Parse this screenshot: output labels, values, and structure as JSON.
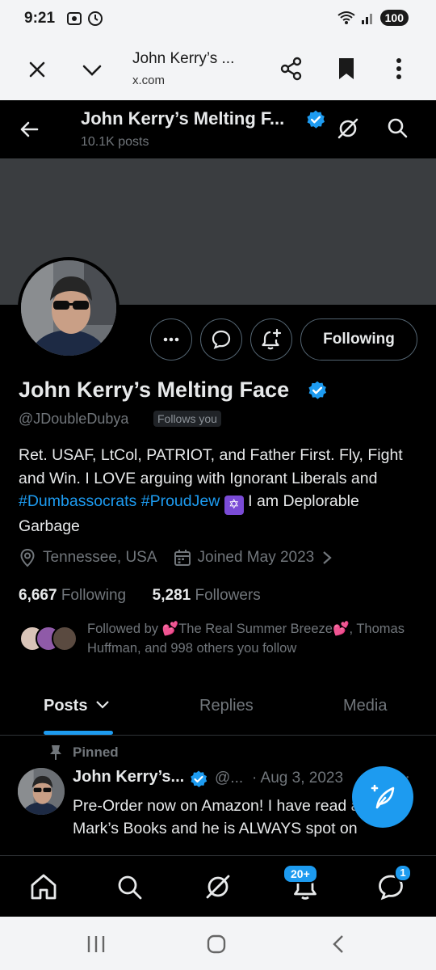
{
  "status_bar": {
    "time": "9:21",
    "battery": "100"
  },
  "browser": {
    "title": "John Kerry’s ...",
    "url": "x.com"
  },
  "header": {
    "name": "John Kerry’s Melting F...",
    "posts": "10.1K posts"
  },
  "profile": {
    "name": "John Kerry’s Melting Face",
    "handle": "@JDoubleDubya",
    "follows_you": "Follows you",
    "following_button": "Following",
    "bio_1": "Ret. USAF, LtCol, PATRIOT, and Father First. Fly, Fight and Win. I LOVE arguing with Ignorant Liberals and ",
    "bio_link_1": "#Dumbassocrats",
    "bio_link_2": "#ProudJew",
    "bio_star": "✡",
    "bio_2": " I am Deplorable Garbage",
    "location": "Tennessee, USA",
    "joined": "Joined May 2023",
    "following_count": "6,667",
    "following_label": "Following",
    "followers_count": "5,281",
    "followers_label": "Followers",
    "followed_by_prefix": "Followed by ",
    "followed_by_name": "The Real Summer Breeze",
    "followed_by_suffix": ", Thomas Huffman, and 998 others you follow"
  },
  "tabs": {
    "posts": "Posts",
    "replies": "Replies",
    "media": "Media"
  },
  "tweet": {
    "pinned": "Pinned",
    "name": "John Kerry’s...",
    "handle": "@...",
    "date": "· Aug 3, 2023",
    "text": "Pre-Order now on Amazon! I have read all of Mark’s Books and he is ALWAYS spot on"
  },
  "bottom_nav": {
    "notifications_badge": "20+",
    "messages_badge": "1"
  },
  "colors": {
    "accent": "#1d9bf0",
    "background": "#000000",
    "muted": "#71767b",
    "banner": "#3a3d40"
  },
  "icons": [
    "close-icon",
    "chevron-down-icon",
    "share-icon",
    "bookmark-icon",
    "more-icon",
    "back-arrow-icon",
    "verified-icon",
    "grok-icon",
    "search-icon",
    "location-icon",
    "calendar-icon",
    "pin-icon",
    "compose-icon",
    "home-icon",
    "bell-icon",
    "messages-icon"
  ]
}
